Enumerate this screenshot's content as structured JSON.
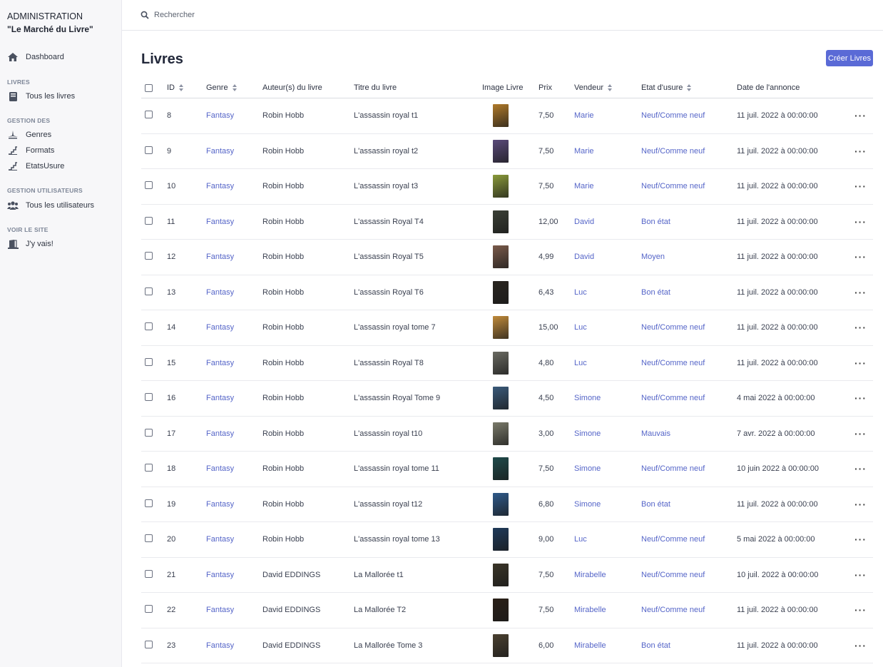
{
  "sidebar": {
    "brand_line1": "ADMINISTRATION",
    "brand_line2": "\"Le Marché du Livre\"",
    "dashboard": "Dashboard",
    "section_livres": "LIVRES",
    "tous_livres": "Tous les livres",
    "section_gestion": "GESTION DES",
    "genres": "Genres",
    "formats": "Formats",
    "etats": "EtatsUsure",
    "section_users": "GESTION UTILISATEURS",
    "tous_users": "Tous les utilisateurs",
    "section_site": "VOIR LE SITE",
    "jy_vais": "J'y vais!"
  },
  "search": {
    "placeholder": "Rechercher"
  },
  "page": {
    "title": "Livres",
    "create_button": "Créer Livres"
  },
  "columns": {
    "id": "ID",
    "genre": "Genre",
    "auteur": "Auteur(s) du livre",
    "titre": "Titre du livre",
    "image": "Image Livre",
    "prix": "Prix",
    "vendeur": "Vendeur",
    "etat": "Etat d'usure",
    "date": "Date de l'annonce"
  },
  "rows": [
    {
      "id": "8",
      "genre": "Fantasy",
      "auteur": "Robin Hobb",
      "titre": "L'assassin royal t1",
      "prix": "7,50",
      "vendeur": "Marie",
      "etat": "Neuf/Comme neuf",
      "date": "11 juil. 2022 à 00:00:00",
      "cover": "#b07a2a"
    },
    {
      "id": "9",
      "genre": "Fantasy",
      "auteur": "Robin Hobb",
      "titre": "L'assassin royal t2",
      "prix": "7,50",
      "vendeur": "Marie",
      "etat": "Neuf/Comme neuf",
      "date": "11 juil. 2022 à 00:00:00",
      "cover": "#5a4a7a"
    },
    {
      "id": "10",
      "genre": "Fantasy",
      "auteur": "Robin Hobb",
      "titre": "L'assassin royal t3",
      "prix": "7,50",
      "vendeur": "Marie",
      "etat": "Neuf/Comme neuf",
      "date": "11 juil. 2022 à 00:00:00",
      "cover": "#8a9a3a"
    },
    {
      "id": "11",
      "genre": "Fantasy",
      "auteur": "Robin Hobb",
      "titre": "L'assassin Royal T4",
      "prix": "12,00",
      "vendeur": "David",
      "etat": "Bon état",
      "date": "11 juil. 2022 à 00:00:00",
      "cover": "#3a3f35"
    },
    {
      "id": "12",
      "genre": "Fantasy",
      "auteur": "Robin Hobb",
      "titre": "L'assassin Royal T5",
      "prix": "4,99",
      "vendeur": "David",
      "etat": "Moyen",
      "date": "11 juil. 2022 à 00:00:00",
      "cover": "#7a5a4a"
    },
    {
      "id": "13",
      "genre": "Fantasy",
      "auteur": "Robin Hobb",
      "titre": "L'assassin Royal T6",
      "prix": "6,43",
      "vendeur": "Luc",
      "etat": "Bon état",
      "date": "11 juil. 2022 à 00:00:00",
      "cover": "#2a2520"
    },
    {
      "id": "14",
      "genre": "Fantasy",
      "auteur": "Robin Hobb",
      "titre": "L'assassin royal tome 7",
      "prix": "15,00",
      "vendeur": "Luc",
      "etat": "Neuf/Comme neuf",
      "date": "11 juil. 2022 à 00:00:00",
      "cover": "#c08a3a"
    },
    {
      "id": "15",
      "genre": "Fantasy",
      "auteur": "Robin Hobb",
      "titre": "L'assassin Royal T8",
      "prix": "4,80",
      "vendeur": "Luc",
      "etat": "Neuf/Comme neuf",
      "date": "11 juil. 2022 à 00:00:00",
      "cover": "#6a6a62"
    },
    {
      "id": "16",
      "genre": "Fantasy",
      "auteur": "Robin Hobb",
      "titre": "L'assassin Royal Tome 9",
      "prix": "4,50",
      "vendeur": "Simone",
      "etat": "Neuf/Comme neuf",
      "date": "4 mai 2022 à 00:00:00",
      "cover": "#3a5a7a"
    },
    {
      "id": "17",
      "genre": "Fantasy",
      "auteur": "Robin Hobb",
      "titre": "L'assassin royal t10",
      "prix": "3,00",
      "vendeur": "Simone",
      "etat": "Mauvais",
      "date": "7 avr. 2022 à 00:00:00",
      "cover": "#7a7a6a"
    },
    {
      "id": "18",
      "genre": "Fantasy",
      "auteur": "Robin Hobb",
      "titre": "L'assassin royal tome 11",
      "prix": "7,50",
      "vendeur": "Simone",
      "etat": "Neuf/Comme neuf",
      "date": "10 juin 2022 à 00:00:00",
      "cover": "#1f4a4a"
    },
    {
      "id": "19",
      "genre": "Fantasy",
      "auteur": "Robin Hobb",
      "titre": "L'assassin royal t12",
      "prix": "6,80",
      "vendeur": "Simone",
      "etat": "Bon état",
      "date": "11 juil. 2022 à 00:00:00",
      "cover": "#2f5a8a"
    },
    {
      "id": "20",
      "genre": "Fantasy",
      "auteur": "Robin Hobb",
      "titre": "L'assassin royal tome 13",
      "prix": "9,00",
      "vendeur": "Luc",
      "etat": "Neuf/Comme neuf",
      "date": "5 mai 2022 à 00:00:00",
      "cover": "#1f3a5a"
    },
    {
      "id": "21",
      "genre": "Fantasy",
      "auteur": "David EDDINGS",
      "titre": "La Mallorée t1",
      "prix": "7,50",
      "vendeur": "Mirabelle",
      "etat": "Neuf/Comme neuf",
      "date": "10 juil. 2022 à 00:00:00",
      "cover": "#3a3528"
    },
    {
      "id": "22",
      "genre": "Fantasy",
      "auteur": "David EDDINGS",
      "titre": "La Mallorée T2",
      "prix": "7,50",
      "vendeur": "Mirabelle",
      "etat": "Neuf/Comme neuf",
      "date": "11 juil. 2022 à 00:00:00",
      "cover": "#2a2018"
    },
    {
      "id": "23",
      "genre": "Fantasy",
      "auteur": "David EDDINGS",
      "titre": "La Mallorée Tome 3",
      "prix": "6,00",
      "vendeur": "Mirabelle",
      "etat": "Bon état",
      "date": "11 juil. 2022 à 00:00:00",
      "cover": "#4a4030"
    }
  ],
  "colors": {
    "accent": "#5a6ad6",
    "link": "#5565c8"
  }
}
